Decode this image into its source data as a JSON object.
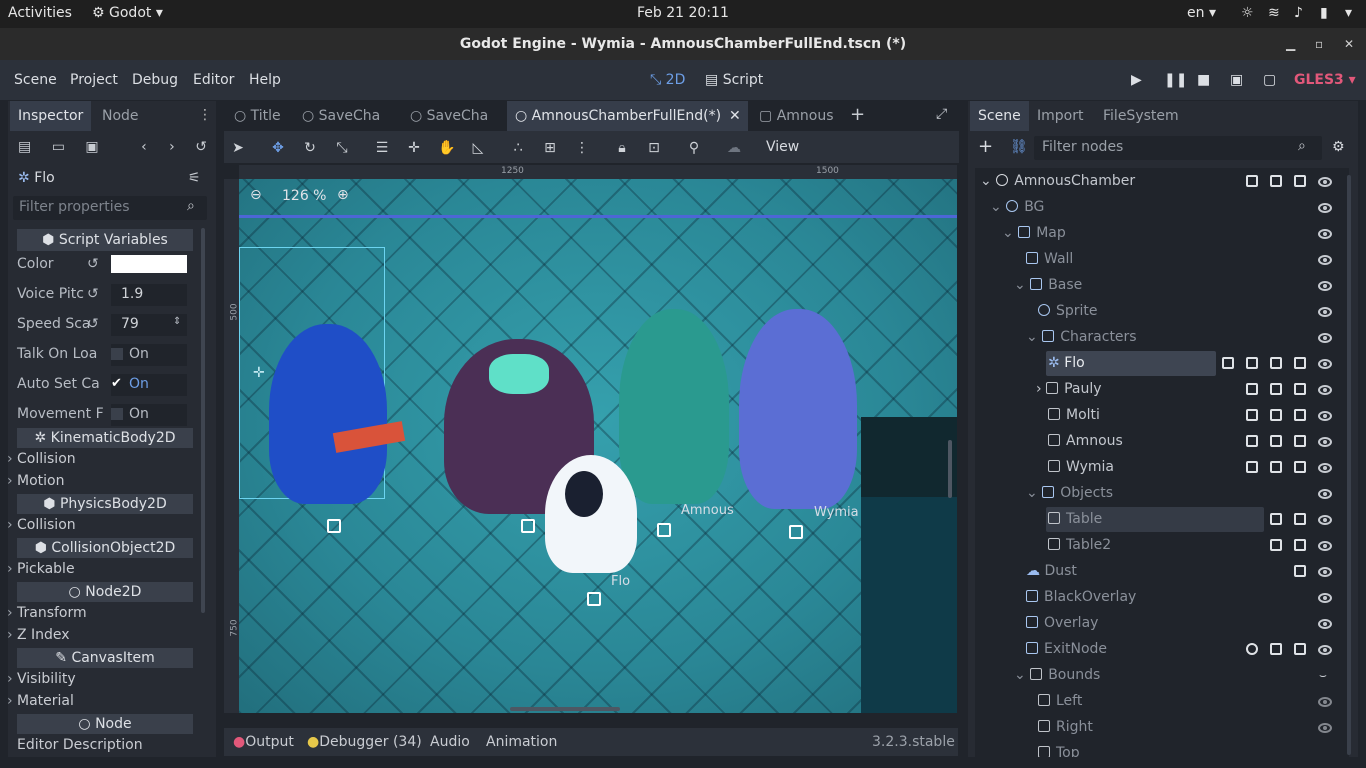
{
  "topbar": {
    "activities": "Activities",
    "app": "Godot",
    "datetime": "Feb 21  20:11",
    "lang": "en"
  },
  "window": {
    "title": "Godot Engine - Wymia - AmnousChamberFullEnd.tscn (*)"
  },
  "menu": {
    "items": [
      "Scene",
      "Project",
      "Debug",
      "Editor",
      "Help"
    ],
    "mode_2d": "2D",
    "mode_script": "Script",
    "renderer": "GLES3"
  },
  "left": {
    "tabs": [
      "Inspector",
      "Node"
    ],
    "node_name": "Flo",
    "filter_placeholder": "Filter properties",
    "script_vars": "Script Variables",
    "props": [
      {
        "label": "Color",
        "value": ""
      },
      {
        "label": "Voice Pitc",
        "value": "1.9"
      },
      {
        "label": "Speed Sca",
        "value": "79"
      },
      {
        "label": "Talk On Loa",
        "value": "On"
      },
      {
        "label": "Auto Set Ca",
        "value": "On"
      },
      {
        "label": "Movement F",
        "value": "On"
      }
    ],
    "sections": [
      "KinematicBody2D",
      "PhysicsBody2D",
      "CollisionObject2D",
      "Node2D",
      "CanvasItem",
      "Node"
    ],
    "categories": [
      "Collision",
      "Motion",
      "Collision",
      "Pickable",
      "Transform",
      "Z Index",
      "Visibility",
      "Material"
    ],
    "footer": "Editor Description"
  },
  "center": {
    "tabs": [
      "Title",
      "SaveCha",
      "SaveCha",
      "AmnousChamberFullEnd(*)",
      "Amnous"
    ],
    "view_label": "View",
    "zoom": "126 %",
    "ruler_top": [
      "1250",
      "1500"
    ],
    "ruler_left": [
      "500",
      "750"
    ],
    "char_labels": [
      "Amnous",
      "Wymia",
      "Flo"
    ],
    "bottom_tabs": [
      "Output",
      "Debugger (34)",
      "Audio",
      "Animation"
    ],
    "version": "3.2.3.stable"
  },
  "right": {
    "tabs": [
      "Scene",
      "Import",
      "FileSystem"
    ],
    "filter_placeholder": "Filter nodes",
    "tree": [
      "AmnousChamber",
      "BG",
      "Map",
      "Wall",
      "Base",
      "Sprite",
      "Characters",
      "Flo",
      "Pauly",
      "Molti",
      "Amnous",
      "Wymia",
      "Objects",
      "Table",
      "Table2",
      "Dust",
      "BlackOverlay",
      "Overlay",
      "ExitNode",
      "Bounds",
      "Left",
      "Right",
      "Top"
    ]
  },
  "colors": {
    "accent": "#6d9ee6",
    "panel": "#272b33",
    "viewport": "#2e8b99",
    "renderer": "#e2587a"
  }
}
